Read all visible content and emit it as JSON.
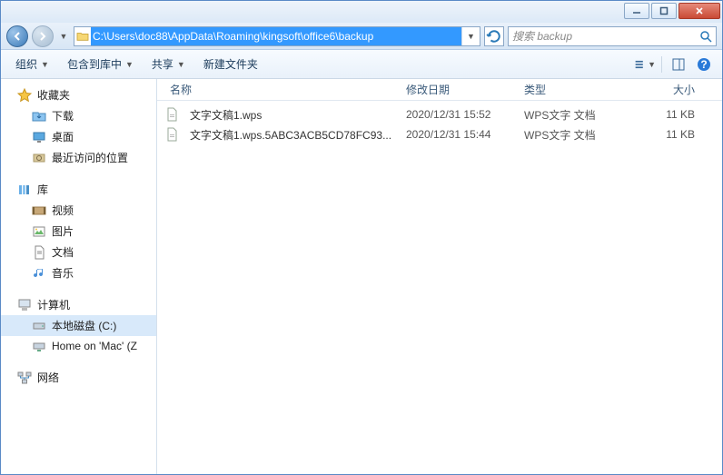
{
  "titlebar": {},
  "nav": {
    "address": "C:\\Users\\doc88\\AppData\\Roaming\\kingsoft\\office6\\backup",
    "search_placeholder": "搜索 backup"
  },
  "toolbar": {
    "organize": "组织",
    "include": "包含到库中",
    "share": "共享",
    "new_folder": "新建文件夹"
  },
  "columns": {
    "name": "名称",
    "date": "修改日期",
    "type": "类型",
    "size": "大小"
  },
  "sidebar": {
    "favorites": {
      "label": "收藏夹"
    },
    "downloads": {
      "label": "下载"
    },
    "desktop": {
      "label": "桌面"
    },
    "recent": {
      "label": "最近访问的位置"
    },
    "libraries": {
      "label": "库"
    },
    "videos": {
      "label": "视频"
    },
    "pictures": {
      "label": "图片"
    },
    "documents": {
      "label": "文档"
    },
    "music": {
      "label": "音乐"
    },
    "computer": {
      "label": "计算机"
    },
    "localdisk": {
      "label": "本地磁盘 (C:)"
    },
    "homemac": {
      "label": "Home on 'Mac' (Z"
    },
    "network": {
      "label": "网络"
    }
  },
  "files": [
    {
      "name": "文字文稿1.wps",
      "date": "2020/12/31 15:52",
      "type": "WPS文字 文档",
      "size": "11 KB"
    },
    {
      "name": "文字文稿1.wps.5ABC3ACB5CD78FC93...",
      "date": "2020/12/31 15:44",
      "type": "WPS文字 文档",
      "size": "11 KB"
    }
  ]
}
